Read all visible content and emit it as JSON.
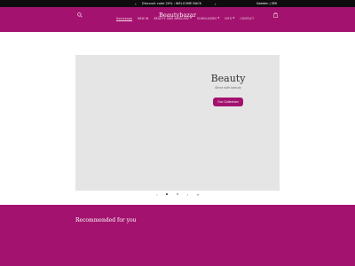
{
  "announcement": {
    "prev_icon": "chevron-left-icon",
    "message": "Discount code 20% : WELCOME BACK",
    "next_icon": "chevron-right-icon",
    "country": "Sweden | SEK"
  },
  "header": {
    "logo": "Beautybazar",
    "search_icon": "search-icon",
    "cart_icon": "bag-icon",
    "background": "#a3126e"
  },
  "nav": {
    "items": [
      {
        "label": "Homepage",
        "active": true,
        "dropdown": false
      },
      {
        "label": "NEW IN",
        "active": false,
        "dropdown": false
      },
      {
        "label": "BEAUTY AND SKINCARE",
        "active": false,
        "dropdown": true
      },
      {
        "label": "SUNGLASSES",
        "active": false,
        "dropdown": true
      },
      {
        "label": "INFO",
        "active": false,
        "dropdown": true
      },
      {
        "label": "CONTACT",
        "active": false,
        "dropdown": false
      }
    ]
  },
  "slideshow": {
    "heading": "Beauty",
    "subheading": "Shine with beauty",
    "button": "Our Collection",
    "current_slide": 1,
    "total_slides": 2,
    "controls": {
      "prev": "‹",
      "pause": "⏸",
      "next": "›"
    }
  },
  "recommended": {
    "title": "Recommended for you"
  },
  "colors": {
    "brand": "#a3126e",
    "announcement_bg": "#0d0d0d",
    "slide_bg": "#e5e5e5"
  }
}
